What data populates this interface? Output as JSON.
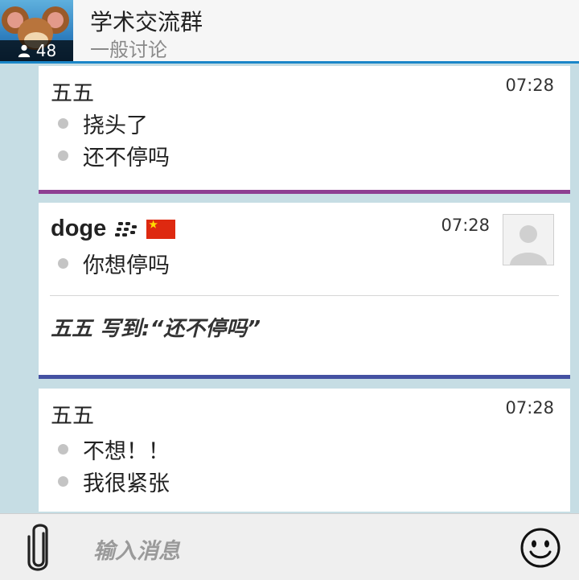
{
  "header": {
    "title": "学术交流群",
    "subtitle": "一般讨论",
    "member_count": "48",
    "accent_color": "#1a86c8"
  },
  "messages": [
    {
      "sender": "五五",
      "time": "07:28",
      "lines": [
        "挠头了",
        "还不停吗"
      ],
      "separator_color": "#8e3f92"
    },
    {
      "sender": "doge",
      "time": "07:28",
      "lines": [
        "你想停吗"
      ],
      "quote": "五五 写到:“还不停吗”",
      "icons": [
        "bbm-icon",
        "china-flag-icon",
        "default-avatar-icon"
      ],
      "separator_color": "#4451a2"
    },
    {
      "sender": "五五",
      "time": "07:28",
      "lines": [
        "不想！！",
        "我很紧张"
      ]
    }
  ],
  "composer": {
    "placeholder": "输入消息",
    "icons": [
      "paperclip-icon",
      "smiley-icon"
    ]
  }
}
